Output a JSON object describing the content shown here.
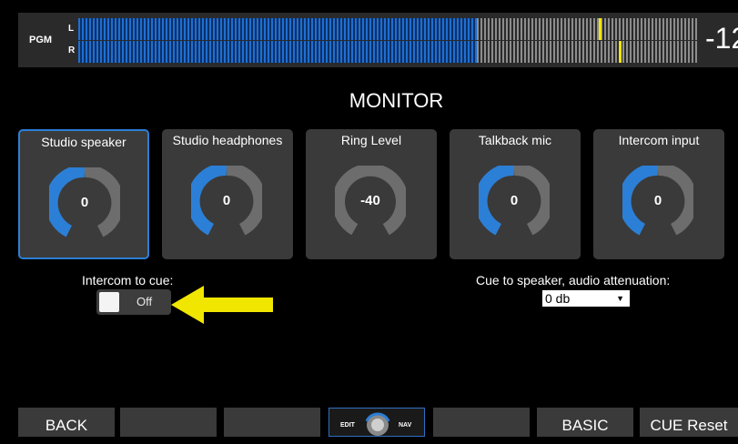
{
  "meter": {
    "program_label": "PGM",
    "left_channel": "L",
    "right_channel": "R",
    "level_readout": "-12"
  },
  "page_title": "MONITOR",
  "knobs": [
    {
      "label": "Studio speaker",
      "value": "0",
      "selected": true
    },
    {
      "label": "Studio headphones",
      "value": "0",
      "selected": false
    },
    {
      "label": "Ring Level",
      "value": "-40",
      "selected": false
    },
    {
      "label": "Talkback mic",
      "value": "0",
      "selected": false
    },
    {
      "label": "Intercom input",
      "value": "0",
      "selected": false
    }
  ],
  "intercom_to_cue": {
    "label": "Intercom to cue:",
    "state_text": "Off"
  },
  "cue_attenuation": {
    "label": "Cue to speaker, audio attenuation:",
    "selected": "0 db"
  },
  "bottom_buttons": {
    "back": "BACK",
    "edit": "EDIT",
    "nav": "NAV",
    "basic": "BASIC",
    "cue_reset": "CUE Reset"
  },
  "colors": {
    "accent": "#2c7fd6",
    "knob_track": "#6d6d6d",
    "highlight_arrow": "#f1e600"
  },
  "icons": [
    "yellow-arrow-icon",
    "rotary-knob-icon"
  ]
}
